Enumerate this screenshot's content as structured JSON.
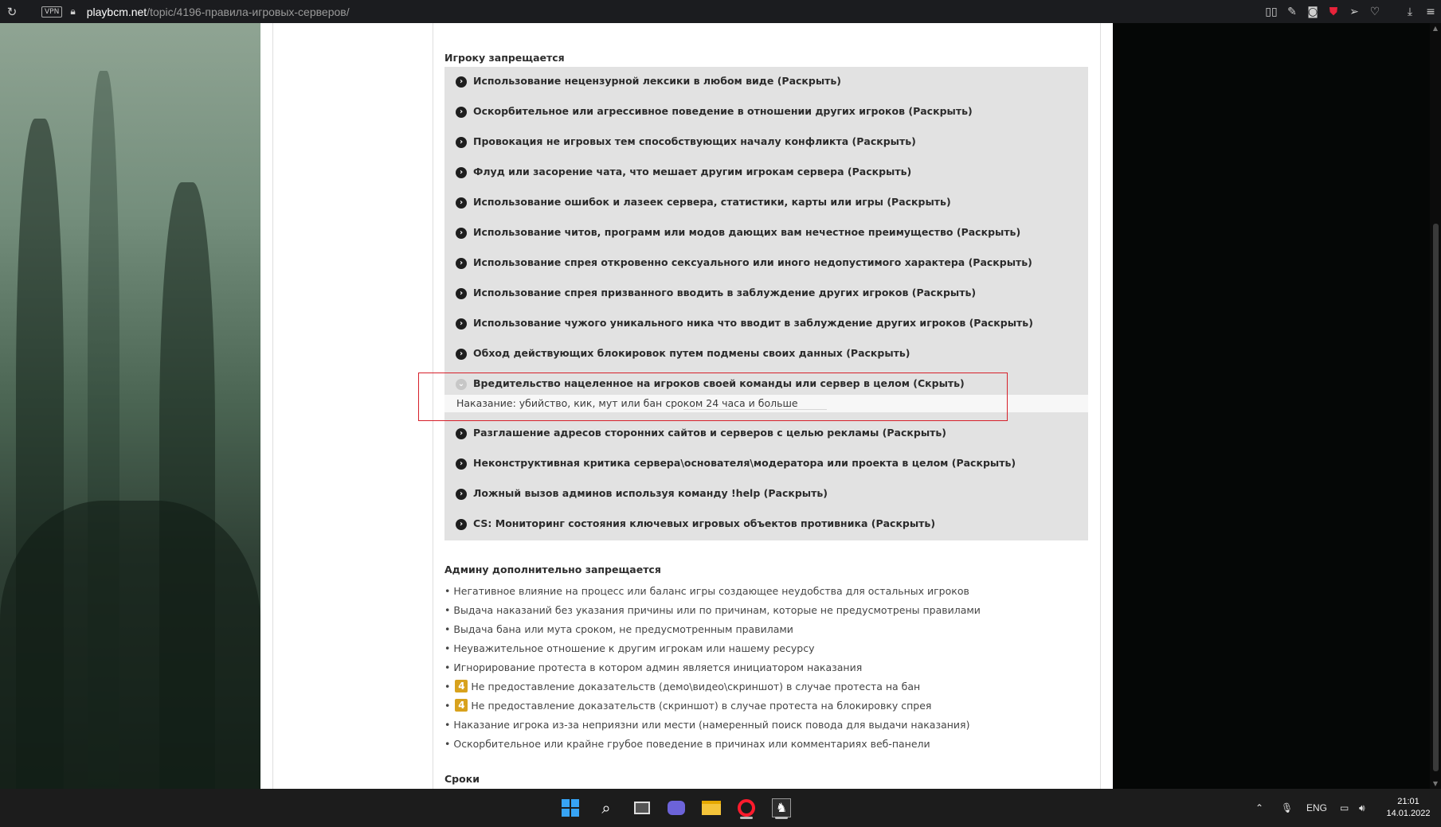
{
  "browser": {
    "vpn_label": "VPN",
    "url_domain": "playbcm.net",
    "url_path": "/topic/4196-правила-игровых-серверов/"
  },
  "content": {
    "player_section_title": "Игроку запрещается",
    "rules": [
      {
        "text": "Использование нецензурной лексики в любом виде (Раскрыть)",
        "expanded": false
      },
      {
        "text": "Оскорбительное или агрессивное поведение в отношении других игроков (Раскрыть)",
        "expanded": false
      },
      {
        "text": "Провокация не игровых тем способствующих началу конфликта (Раскрыть)",
        "expanded": false
      },
      {
        "text": "Флуд или засорение чата, что мешает другим игрокам сервера (Раскрыть)",
        "expanded": false
      },
      {
        "text": "Использование ошибок и лазеек сервера, статистики, карты или игры (Раскрыть)",
        "expanded": false
      },
      {
        "text": "Использование читов, программ или модов дающих вам нечестное преимущество (Раскрыть)",
        "expanded": false
      },
      {
        "text": "Использование спрея откровенно сексуального или иного недопустимого характера (Раскрыть)",
        "expanded": false
      },
      {
        "text": "Использование спрея призванного вводить в заблуждение других игроков (Раскрыть)",
        "expanded": false
      },
      {
        "text": "Использование чужого уникального ника что вводит в заблуждение других игроков (Раскрыть)",
        "expanded": false
      },
      {
        "text": "Обход действующих блокировок путем подмены своих данных (Раскрыть)",
        "expanded": false
      },
      {
        "text": "Вредительство нацеленное на игроков своей команды или сервер в целом (Скрыть)",
        "expanded": true,
        "detail": "Наказание: убийство, кик, мут или бан сроком 24 часа и больше"
      },
      {
        "text": "Разглашение адресов сторонних сайтов и серверов с целью рекламы (Раскрыть)",
        "expanded": false
      },
      {
        "text": "Неконструктивная критика сервера\\основателя\\модератора или проекта в целом (Раскрыть)",
        "expanded": false
      },
      {
        "text": "Ложный вызов админов используя команду !help (Раскрыть)",
        "expanded": false
      },
      {
        "text": "CS: Мониторинг состояния ключевых игровых объектов противника (Раскрыть)",
        "expanded": false
      }
    ],
    "admin_section_title": "Админу дополнительно запрещается",
    "admin_items": [
      {
        "text": "Негативное влияние на процесс или баланс игры создающее неудобства для остальных игроков",
        "badge": ""
      },
      {
        "text": "Выдача наказаний без указания причины или по причинам, которые не предусмотрены правилами",
        "badge": ""
      },
      {
        "text": "Выдача бана или мута сроком, не предусмотренным правилами",
        "badge": ""
      },
      {
        "text": "Неуважительное отношение к другим игрокам или нашему ресурсу",
        "badge": ""
      },
      {
        "text": "Игнорирование протеста в котором админ является инициатором наказания",
        "badge": ""
      },
      {
        "text": "Не предоставление доказательств (демо\\видео\\скриншот) в случае протеста на бан",
        "badge": "4"
      },
      {
        "text": "Не предоставление доказательств (скриншот) в случае протеста на блокировку спрея",
        "badge": "4"
      },
      {
        "text": "Наказание игрока из-за неприязни или мести (намеренный поиск повода для выдачи наказания)",
        "badge": ""
      },
      {
        "text": "Оскорбительное или крайне грубое поведение в причинах или комментариях веб-панели",
        "badge": ""
      }
    ],
    "admin_bullet": "•",
    "terms_section_title": "Сроки"
  },
  "taskbar": {
    "apps": [
      "start-icon",
      "search-icon",
      "task-view-icon",
      "chat-icon",
      "file-explorer-icon",
      "opera-icon",
      "counter-strike-icon"
    ],
    "tray_lang": "ENG",
    "time": "21:01",
    "date": "14.01.2022"
  },
  "colors": {
    "highlight_border": "#d6202a",
    "rules_bg": "#e2e2e2",
    "badge_bg": "#d8a21d"
  }
}
